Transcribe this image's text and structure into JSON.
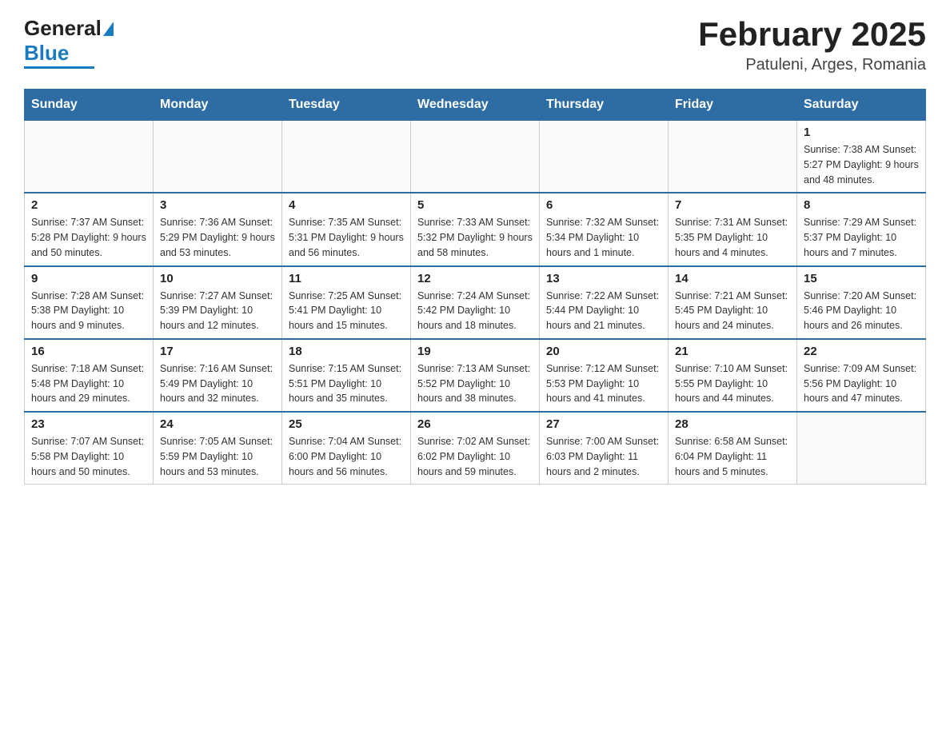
{
  "header": {
    "title": "February 2025",
    "subtitle": "Patuleni, Arges, Romania",
    "logo_general": "General",
    "logo_blue": "Blue"
  },
  "weekdays": [
    "Sunday",
    "Monday",
    "Tuesday",
    "Wednesday",
    "Thursday",
    "Friday",
    "Saturday"
  ],
  "weeks": [
    [
      {
        "day": "",
        "info": ""
      },
      {
        "day": "",
        "info": ""
      },
      {
        "day": "",
        "info": ""
      },
      {
        "day": "",
        "info": ""
      },
      {
        "day": "",
        "info": ""
      },
      {
        "day": "",
        "info": ""
      },
      {
        "day": "1",
        "info": "Sunrise: 7:38 AM\nSunset: 5:27 PM\nDaylight: 9 hours and 48 minutes."
      }
    ],
    [
      {
        "day": "2",
        "info": "Sunrise: 7:37 AM\nSunset: 5:28 PM\nDaylight: 9 hours and 50 minutes."
      },
      {
        "day": "3",
        "info": "Sunrise: 7:36 AM\nSunset: 5:29 PM\nDaylight: 9 hours and 53 minutes."
      },
      {
        "day": "4",
        "info": "Sunrise: 7:35 AM\nSunset: 5:31 PM\nDaylight: 9 hours and 56 minutes."
      },
      {
        "day": "5",
        "info": "Sunrise: 7:33 AM\nSunset: 5:32 PM\nDaylight: 9 hours and 58 minutes."
      },
      {
        "day": "6",
        "info": "Sunrise: 7:32 AM\nSunset: 5:34 PM\nDaylight: 10 hours and 1 minute."
      },
      {
        "day": "7",
        "info": "Sunrise: 7:31 AM\nSunset: 5:35 PM\nDaylight: 10 hours and 4 minutes."
      },
      {
        "day": "8",
        "info": "Sunrise: 7:29 AM\nSunset: 5:37 PM\nDaylight: 10 hours and 7 minutes."
      }
    ],
    [
      {
        "day": "9",
        "info": "Sunrise: 7:28 AM\nSunset: 5:38 PM\nDaylight: 10 hours and 9 minutes."
      },
      {
        "day": "10",
        "info": "Sunrise: 7:27 AM\nSunset: 5:39 PM\nDaylight: 10 hours and 12 minutes."
      },
      {
        "day": "11",
        "info": "Sunrise: 7:25 AM\nSunset: 5:41 PM\nDaylight: 10 hours and 15 minutes."
      },
      {
        "day": "12",
        "info": "Sunrise: 7:24 AM\nSunset: 5:42 PM\nDaylight: 10 hours and 18 minutes."
      },
      {
        "day": "13",
        "info": "Sunrise: 7:22 AM\nSunset: 5:44 PM\nDaylight: 10 hours and 21 minutes."
      },
      {
        "day": "14",
        "info": "Sunrise: 7:21 AM\nSunset: 5:45 PM\nDaylight: 10 hours and 24 minutes."
      },
      {
        "day": "15",
        "info": "Sunrise: 7:20 AM\nSunset: 5:46 PM\nDaylight: 10 hours and 26 minutes."
      }
    ],
    [
      {
        "day": "16",
        "info": "Sunrise: 7:18 AM\nSunset: 5:48 PM\nDaylight: 10 hours and 29 minutes."
      },
      {
        "day": "17",
        "info": "Sunrise: 7:16 AM\nSunset: 5:49 PM\nDaylight: 10 hours and 32 minutes."
      },
      {
        "day": "18",
        "info": "Sunrise: 7:15 AM\nSunset: 5:51 PM\nDaylight: 10 hours and 35 minutes."
      },
      {
        "day": "19",
        "info": "Sunrise: 7:13 AM\nSunset: 5:52 PM\nDaylight: 10 hours and 38 minutes."
      },
      {
        "day": "20",
        "info": "Sunrise: 7:12 AM\nSunset: 5:53 PM\nDaylight: 10 hours and 41 minutes."
      },
      {
        "day": "21",
        "info": "Sunrise: 7:10 AM\nSunset: 5:55 PM\nDaylight: 10 hours and 44 minutes."
      },
      {
        "day": "22",
        "info": "Sunrise: 7:09 AM\nSunset: 5:56 PM\nDaylight: 10 hours and 47 minutes."
      }
    ],
    [
      {
        "day": "23",
        "info": "Sunrise: 7:07 AM\nSunset: 5:58 PM\nDaylight: 10 hours and 50 minutes."
      },
      {
        "day": "24",
        "info": "Sunrise: 7:05 AM\nSunset: 5:59 PM\nDaylight: 10 hours and 53 minutes."
      },
      {
        "day": "25",
        "info": "Sunrise: 7:04 AM\nSunset: 6:00 PM\nDaylight: 10 hours and 56 minutes."
      },
      {
        "day": "26",
        "info": "Sunrise: 7:02 AM\nSunset: 6:02 PM\nDaylight: 10 hours and 59 minutes."
      },
      {
        "day": "27",
        "info": "Sunrise: 7:00 AM\nSunset: 6:03 PM\nDaylight: 11 hours and 2 minutes."
      },
      {
        "day": "28",
        "info": "Sunrise: 6:58 AM\nSunset: 6:04 PM\nDaylight: 11 hours and 5 minutes."
      },
      {
        "day": "",
        "info": ""
      }
    ]
  ]
}
